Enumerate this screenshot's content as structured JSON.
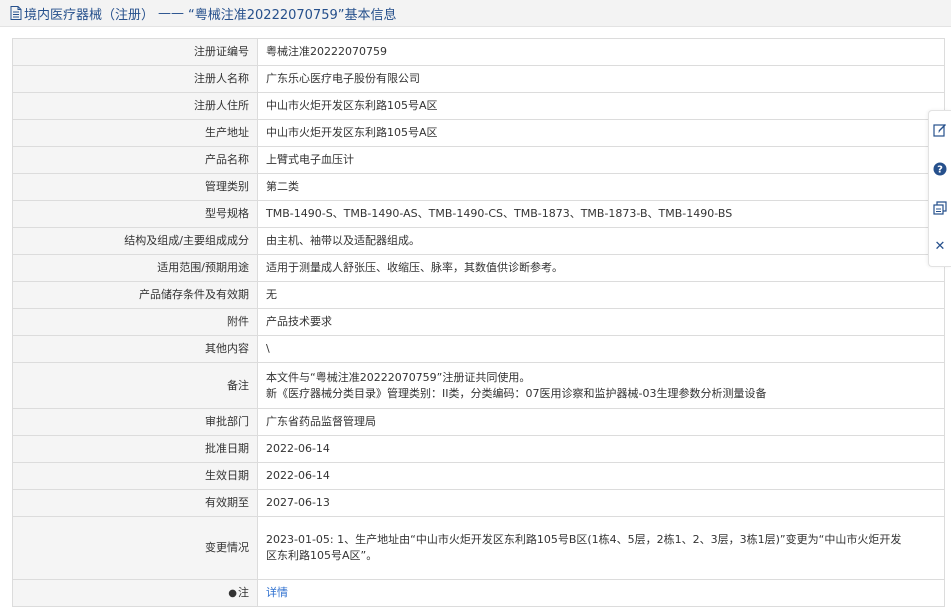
{
  "header": {
    "category": "境内医疗器械（注册）",
    "separator": "——",
    "record_title": "“粤械注准20222070759”基本信息"
  },
  "rows": [
    {
      "label": "注册证编号",
      "lines": [
        "粤械注准20222070759"
      ]
    },
    {
      "label": "注册人名称",
      "lines": [
        "广东乐心医疗电子股份有限公司"
      ]
    },
    {
      "label": "注册人住所",
      "lines": [
        "中山市火炬开发区东利路105号A区"
      ]
    },
    {
      "label": "生产地址",
      "lines": [
        "中山市火炬开发区东利路105号A区"
      ]
    },
    {
      "label": "产品名称",
      "lines": [
        "上臂式电子血压计"
      ]
    },
    {
      "label": "管理类别",
      "lines": [
        "第二类"
      ]
    },
    {
      "label": "型号规格",
      "lines": [
        "TMB-1490-S、TMB-1490-AS、TMB-1490-CS、TMB-1873、TMB-1873-B、TMB-1490-BS"
      ]
    },
    {
      "label": "结构及组成/主要组成成分",
      "lines": [
        "由主机、袖带以及适配器组成。"
      ]
    },
    {
      "label": "适用范围/预期用途",
      "lines": [
        "适用于测量成人舒张压、收缩压、脉率，其数值供诊断参考。"
      ]
    },
    {
      "label": "产品储存条件及有效期",
      "lines": [
        "无"
      ]
    },
    {
      "label": "附件",
      "lines": [
        "产品技术要求"
      ]
    },
    {
      "label": "其他内容",
      "lines": [
        "\\"
      ]
    },
    {
      "label": "备注",
      "lines": [
        "本文件与“粤械注准20222070759”注册证共同使用。",
        "新《医疗器械分类目录》管理类别：II类，分类编码：07医用诊察和监护器械-03生理参数分析测量设备"
      ]
    },
    {
      "label": "审批部门",
      "lines": [
        "广东省药品监督管理局"
      ]
    },
    {
      "label": "批准日期",
      "lines": [
        "2022-06-14"
      ]
    },
    {
      "label": "生效日期",
      "lines": [
        "2022-06-14"
      ]
    },
    {
      "label": "有效期至",
      "lines": [
        "2027-06-13"
      ]
    },
    {
      "label": "变更情况",
      "lines": [
        "2023-01-05: 1、生产地址由“中山市火炬开发区东利路105号B区(1栋4、5层，2栋1、2、3层，3栋1层)”变更为“中山市火炬开发",
        "区东利路105号A区”。"
      ]
    }
  ],
  "note_row": {
    "label": "注",
    "pin_glyph": "●",
    "link_text": "详情"
  },
  "side_toolbar": {
    "icons": [
      "edit-icon",
      "help-icon",
      "copy-icon",
      "close-icon"
    ],
    "help_glyph": "?",
    "close_glyph": "✕",
    "accent_color": "#26508c"
  }
}
